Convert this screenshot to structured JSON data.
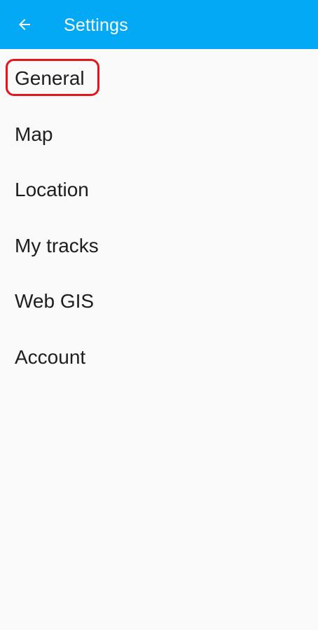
{
  "header": {
    "title": "Settings",
    "back_icon": "arrow-back-icon",
    "background_color": "#03a9f4",
    "text_color": "#ffffff"
  },
  "settings": {
    "items": [
      {
        "label": "General",
        "highlighted": true
      },
      {
        "label": "Map"
      },
      {
        "label": "Location"
      },
      {
        "label": "My tracks"
      },
      {
        "label": "Web GIS"
      },
      {
        "label": "Account"
      }
    ],
    "highlight_color": "#e3161e"
  }
}
